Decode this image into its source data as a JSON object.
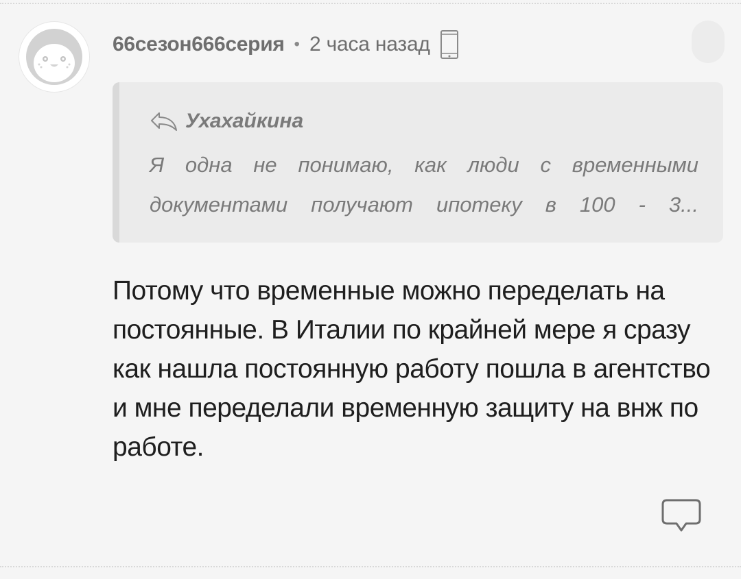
{
  "comment": {
    "author": "66сезон666серия",
    "separator": "•",
    "time": "2 часа назад",
    "device_icon": "phone-icon",
    "avatar_icon": "penguin-avatar",
    "quote": {
      "reply_icon": "reply-arrow-icon",
      "author": "Ухахайкина",
      "text": "Я одна не понимаю, как люди с временными документами получают ипотеку в 100 - 3..."
    },
    "body": "Потому что временные можно переделать на постоянные. В Италии по крайней мере я сразу как нашла постоянную работу пошла в агентство и мне переделали временную защиту на внж по работе.",
    "reply_button_icon": "comment-bubble-icon",
    "more_button_icon": "more-icon"
  }
}
